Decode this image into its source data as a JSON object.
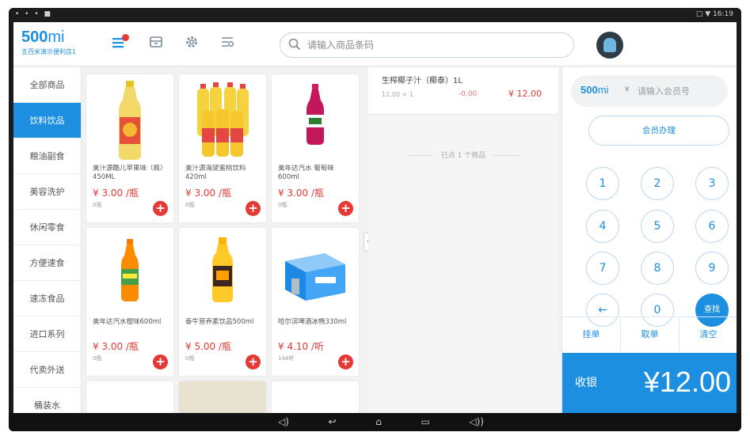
{
  "statusbar": {
    "left": "• • • ■",
    "time": "□ ▼ 16:19"
  },
  "header": {
    "logo_main": "500",
    "logo_suffix": "mi",
    "logo_sub": "五百米演示便利店1",
    "search_placeholder": "请输入商品条码",
    "icons": [
      "menu-list-icon",
      "cash-drawer-icon",
      "gear-icon",
      "settings-sliders-icon"
    ]
  },
  "categories": [
    {
      "label": "全部商品",
      "active": false
    },
    {
      "label": "饮料饮品",
      "active": true
    },
    {
      "label": "粮油副食",
      "active": false
    },
    {
      "label": "美容洗护",
      "active": false
    },
    {
      "label": "休闲零食",
      "active": false
    },
    {
      "label": "方便速食",
      "active": false
    },
    {
      "label": "速冻食品",
      "active": false
    },
    {
      "label": "进口系列",
      "active": false
    },
    {
      "label": "代卖外送",
      "active": false
    },
    {
      "label": "桶装水",
      "active": false
    }
  ],
  "products": [
    {
      "name": "美汁源酷儿苹果味（瓶）450ML",
      "price": "¥ 3.00 /瓶",
      "stock": "0瓶",
      "image": "apple-juice-bottle"
    },
    {
      "name": "美汁源海黛蜜桃饮料420ml",
      "price": "¥ 3.00 /瓶",
      "stock": "0瓶",
      "image": "peach-juice-pack"
    },
    {
      "name": "美年达汽水 葡萄味600ml",
      "price": "¥ 3.00 /瓶",
      "stock": "0瓶",
      "image": "grape-soda-bottle"
    },
    {
      "name": "美年达汽水橙味600ml",
      "price": "¥ 3.00 /瓶",
      "stock": "0瓶",
      "image": "orange-soda-bottle"
    },
    {
      "name": "泰牛营养素饮品500ml",
      "price": "¥ 5.00 /瓶",
      "stock": "0瓶",
      "image": "energy-drink-bottle"
    },
    {
      "name": "哈尔滨啤酒冰畅330ml",
      "price": "¥ 4.10 /听",
      "stock": "144听",
      "image": "beer-case"
    }
  ],
  "order": {
    "item_name": "生榨椰子汁（椰泰）1L",
    "item_qty": "12.00 × 1",
    "item_discount": "-0.00",
    "item_total": "¥ 12.00",
    "count_text": "已点 1 个商品"
  },
  "member": {
    "brand": "500",
    "brand_suffix": "mi",
    "placeholder": "请输入会员号",
    "register_label": "会员办理"
  },
  "keypad": [
    "1",
    "2",
    "3",
    "4",
    "5",
    "6",
    "7",
    "8",
    "9",
    "←",
    "0",
    "查找"
  ],
  "actions": {
    "hold": "挂单",
    "retrieve": "取单",
    "clear": "清空"
  },
  "checkout": {
    "label": "收银",
    "total": "¥12.00"
  },
  "colors": {
    "accent": "#1d8fe0",
    "price": "#e53935",
    "panel_bg": "#f2f2f2"
  }
}
